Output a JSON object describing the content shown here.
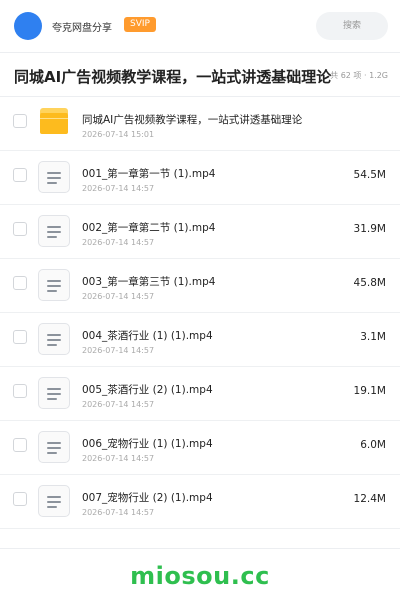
{
  "header": {
    "username": "夸克网盘分享",
    "vip_badge": "SVIP",
    "search_placeholder": "搜索",
    "avatar_color": "#2f80f0",
    "vip_color": "#ff9b2e"
  },
  "share": {
    "title": "同城AI广告视频教学课程，一站式讲透基础理论",
    "meta": "共 62 项 · 1.2G"
  },
  "items": [
    {
      "name": "同城AI广告视频教学课程，一站式讲透基础理论",
      "date": "2026-07-14 15:01",
      "size": "",
      "type": "folder"
    },
    {
      "name": "001_第一章第一节 (1).mp4",
      "date": "2026-07-14 14:57",
      "size": "54.5M",
      "type": "file"
    },
    {
      "name": "002_第一章第二节 (1).mp4",
      "date": "2026-07-14 14:57",
      "size": "31.9M",
      "type": "file"
    },
    {
      "name": "003_第一章第三节 (1).mp4",
      "date": "2026-07-14 14:57",
      "size": "45.8M",
      "type": "file"
    },
    {
      "name": "004_茶酒行业 (1) (1).mp4",
      "date": "2026-07-14 14:57",
      "size": "3.1M",
      "type": "file"
    },
    {
      "name": "005_茶酒行业 (2) (1).mp4",
      "date": "2026-07-14 14:57",
      "size": "19.1M",
      "type": "file"
    },
    {
      "name": "006_宠物行业 (1) (1).mp4",
      "date": "2026-07-14 14:57",
      "size": "6.0M",
      "type": "file"
    },
    {
      "name": "007_宠物行业 (2) (1).mp4",
      "date": "2026-07-14 14:57",
      "size": "12.4M",
      "type": "file"
    }
  ],
  "watermark": {
    "text": "miosou.cc",
    "color": "#2fbf4f"
  }
}
